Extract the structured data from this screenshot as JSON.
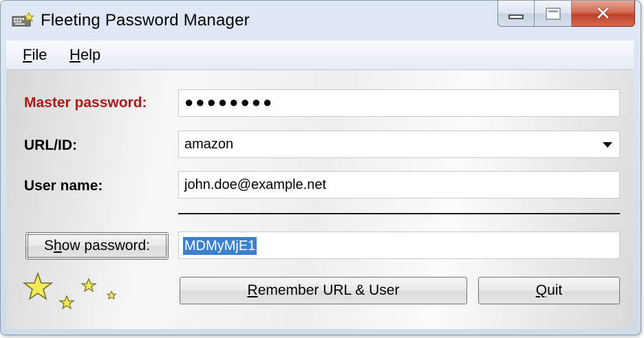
{
  "window": {
    "title": "Fleeting Password Manager",
    "icon": "keyboard-stars-icon",
    "controls": {
      "minimize": "minimize-icon",
      "maximize": "maximize-icon",
      "close": "✕"
    }
  },
  "menu": {
    "items": [
      {
        "accel": "F",
        "rest": "ile"
      },
      {
        "accel": "H",
        "rest": "elp"
      }
    ]
  },
  "form": {
    "master_label": "Master password:",
    "master_value": "●●●●●●●●",
    "url_label": "URL/ID:",
    "url_value": "amazon",
    "user_label": "User name:",
    "user_value": "john.doe@example.net",
    "show_button": {
      "before": "S",
      "accel": "h",
      "after": "ow password:"
    },
    "password_value": "MDMyMjE1"
  },
  "buttons": {
    "remember": {
      "accel": "R",
      "rest": "emember URL & User"
    },
    "quit": {
      "accel": "Q",
      "rest": "uit"
    }
  },
  "colors": {
    "master_label": "#b01818",
    "selection": "#3b7fcf",
    "star_fill": "#f3e85a"
  }
}
